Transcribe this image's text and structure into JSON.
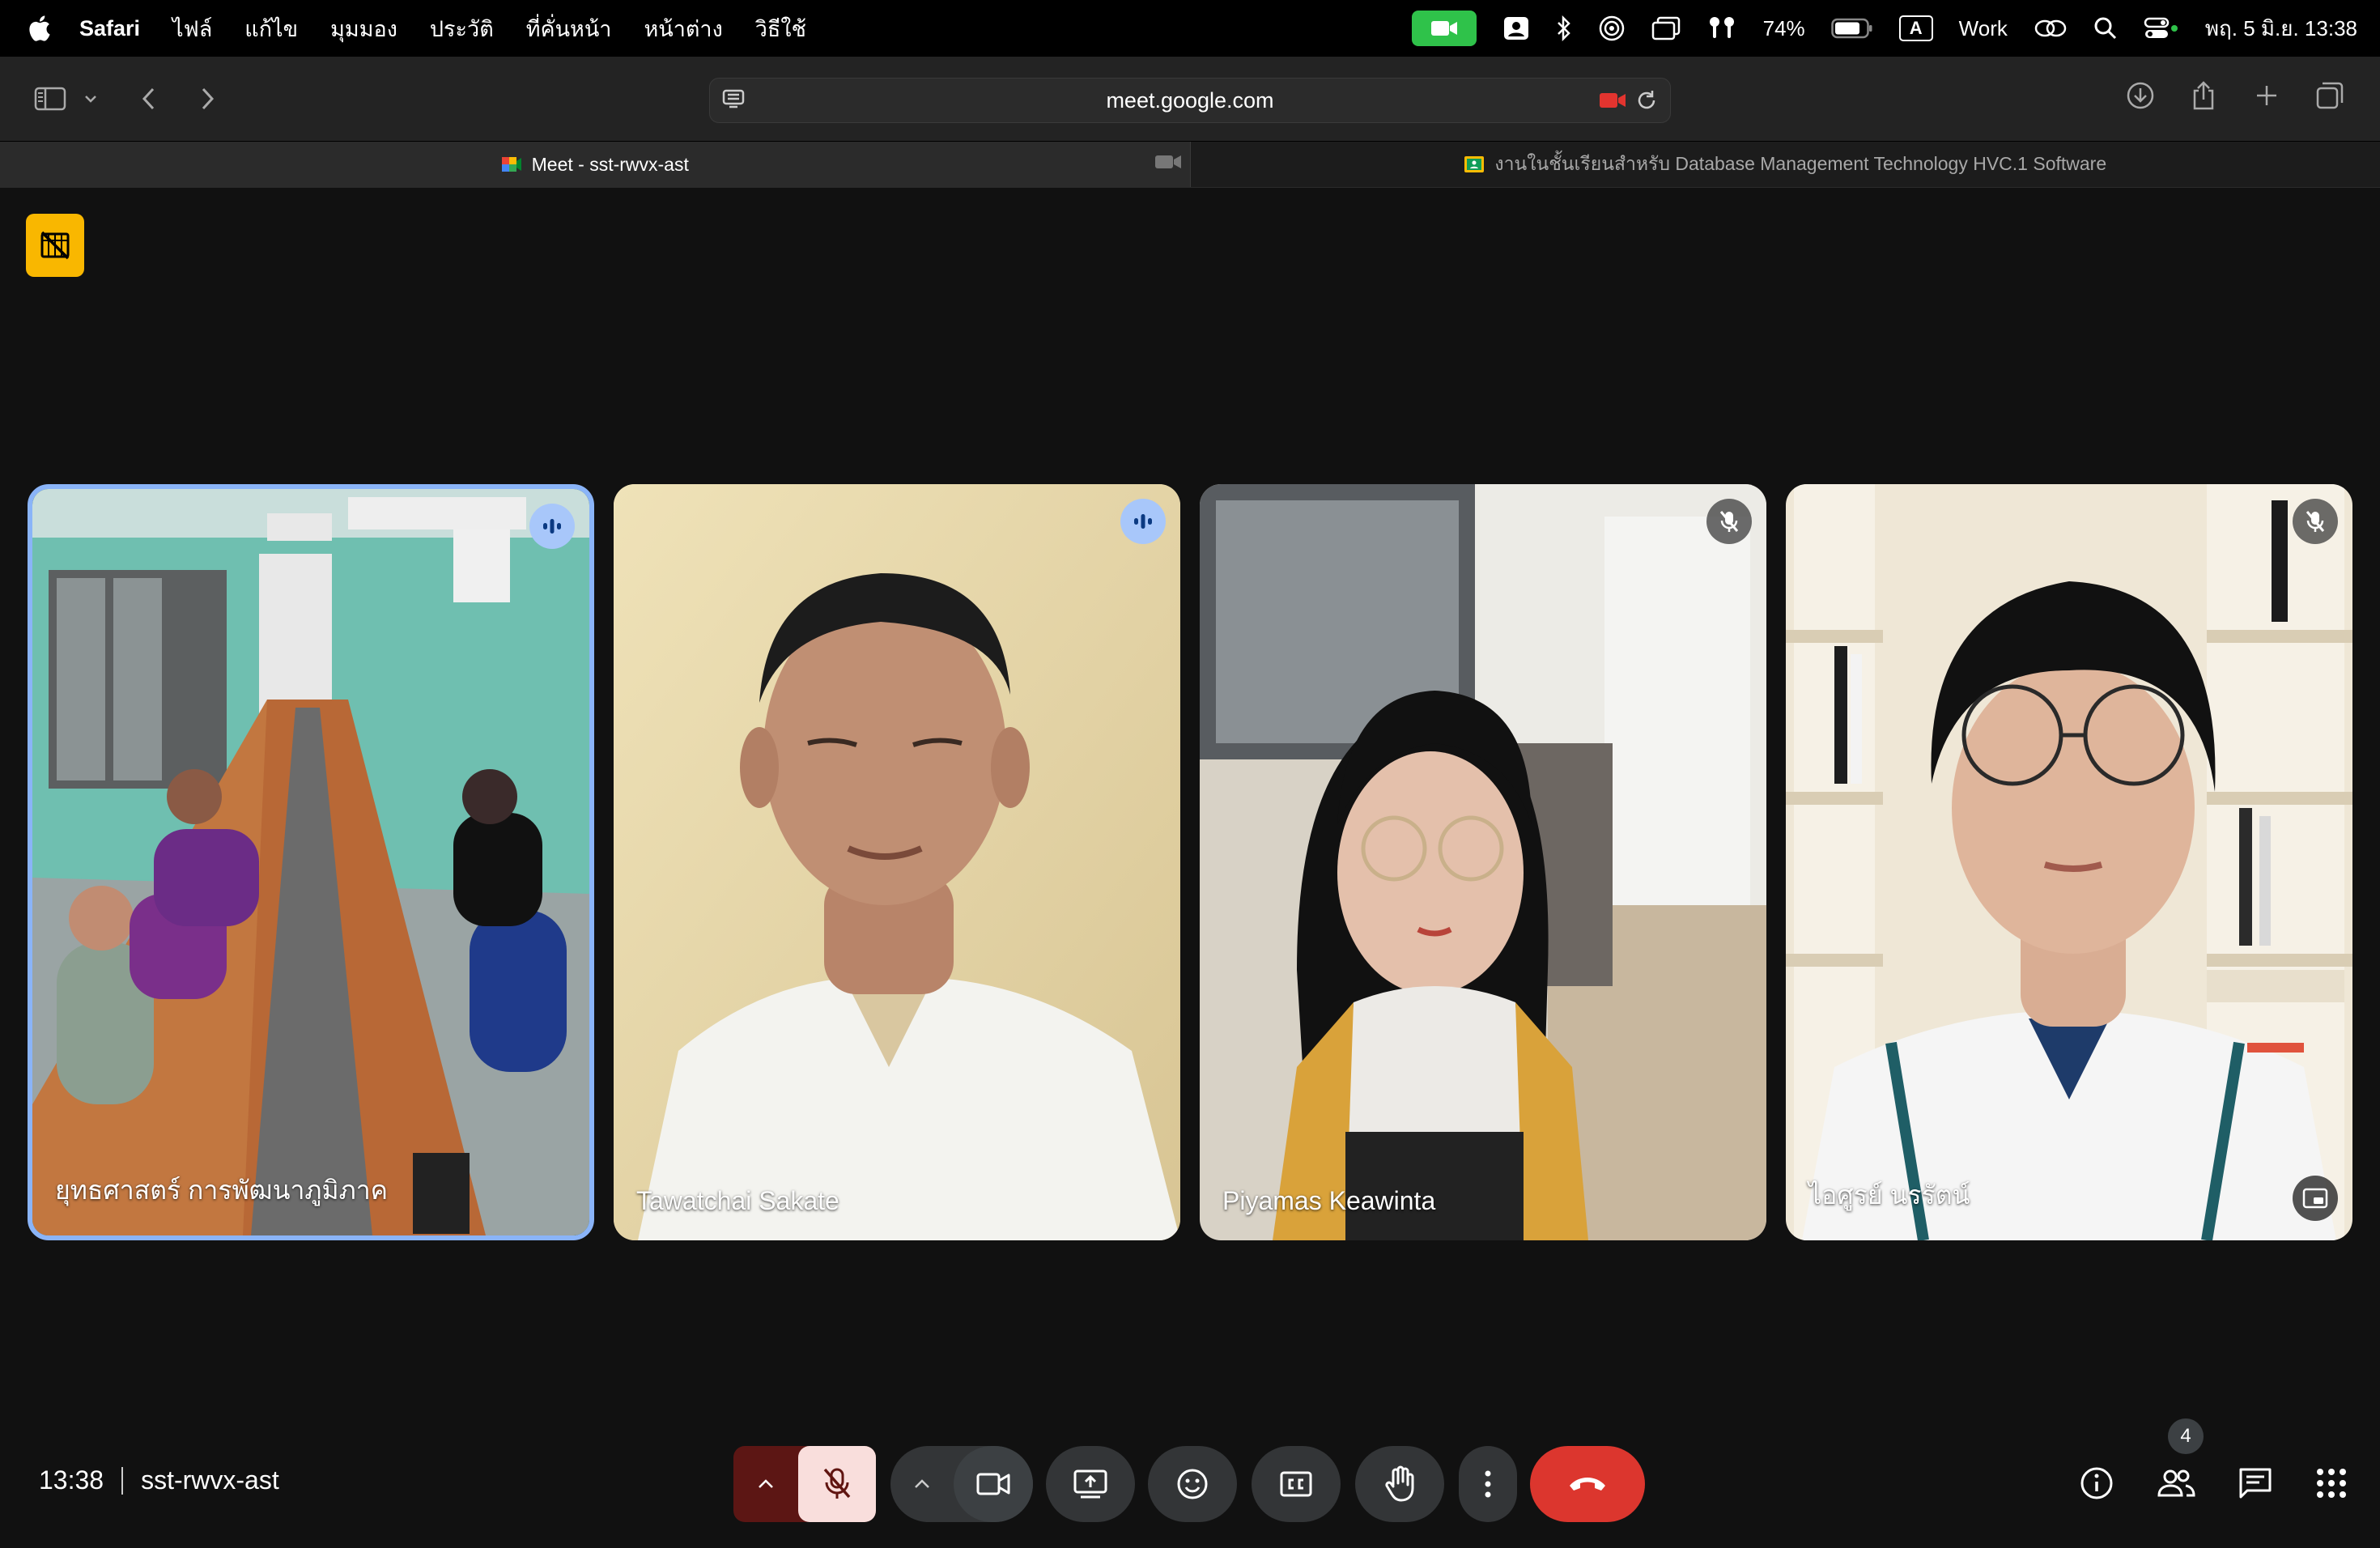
{
  "menubar": {
    "app_name": "Safari",
    "menus": [
      "ไฟล์",
      "แก้ไข",
      "มุมมอง",
      "ประวัติ",
      "ที่คั่นหน้า",
      "หน้าต่าง",
      "วิธีใช้"
    ],
    "battery": "74%",
    "input_source": "A",
    "focus_label": "Work",
    "datetime": "พฤ. 5 มิ.ย.  13:38"
  },
  "browser": {
    "url": "meet.google.com",
    "tabs": [
      {
        "label": "Meet - sst-rwvx-ast",
        "active": true
      },
      {
        "label": "งานในชั้นเรียนสำหรับ Database Management Technology HVC.1 Software",
        "active": false
      }
    ]
  },
  "meet": {
    "participants": [
      {
        "name": "ยุทธศาสตร์ การพัฒนาภูมิภาค",
        "status": "speaking"
      },
      {
        "name": "Tawatchai Sakate",
        "status": "speaking"
      },
      {
        "name": "Piyamas Keawinta",
        "status": "muted"
      },
      {
        "name": "ไอศูรย์ นรรัตน์",
        "status": "muted"
      }
    ],
    "time": "13:38",
    "meeting_code": "sst-rwvx-ast",
    "people_count": "4"
  },
  "colors": {
    "accent_blue": "#8ab4f8",
    "end_call_red": "#dc362e",
    "hide_badge_yellow": "#f9b700",
    "facetime_green": "#2fc24a"
  }
}
